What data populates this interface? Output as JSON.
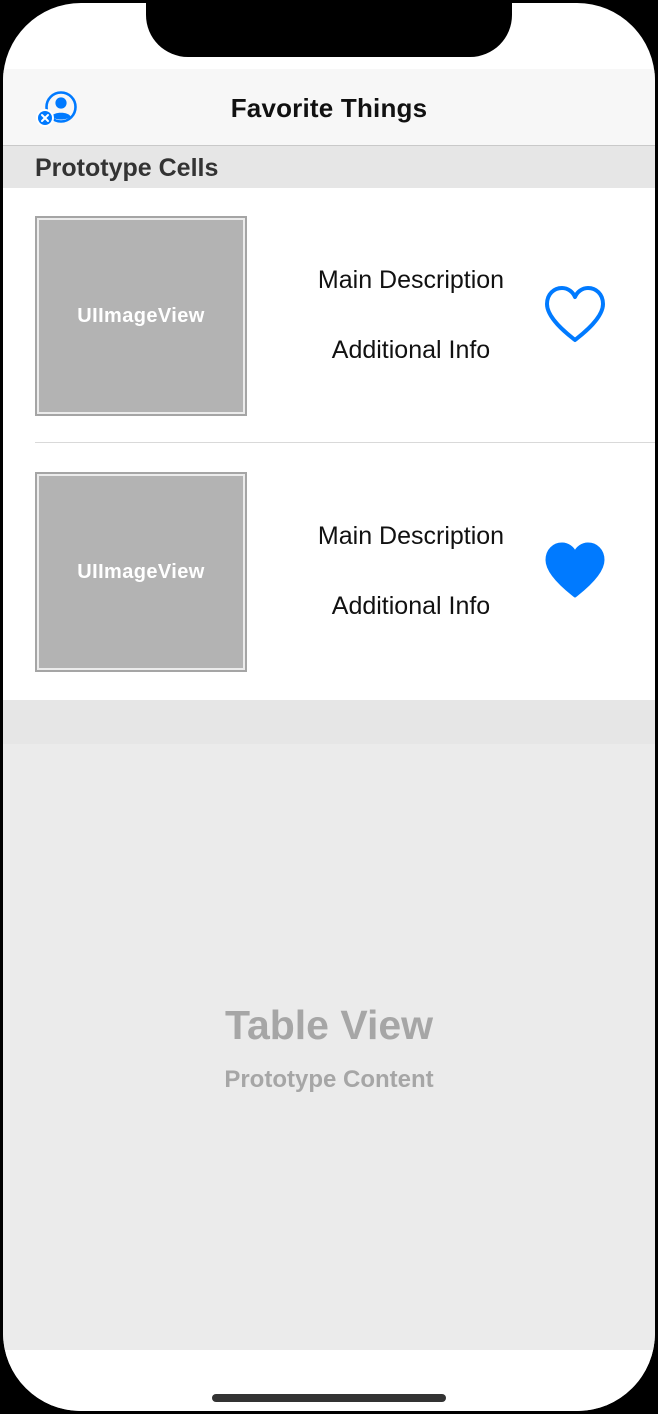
{
  "nav": {
    "title": "Favorite Things",
    "left_icon": "person-remove-icon"
  },
  "section": {
    "header": "Prototype Cells"
  },
  "cells": [
    {
      "image_label": "UIImageView",
      "main_description": "Main Description",
      "additional_info": "Additional Info",
      "favorite_icon": "heart-outline-icon"
    },
    {
      "image_label": "UIImageView",
      "main_description": "Main Description",
      "additional_info": "Additional Info",
      "favorite_icon": "heart-filled-icon"
    }
  ],
  "prototype": {
    "title": "Table View",
    "subtitle": "Prototype Content"
  },
  "colors": {
    "accent": "#007aff",
    "placeholder": "#b3b3b3",
    "section_bg": "#e6e6e6"
  }
}
